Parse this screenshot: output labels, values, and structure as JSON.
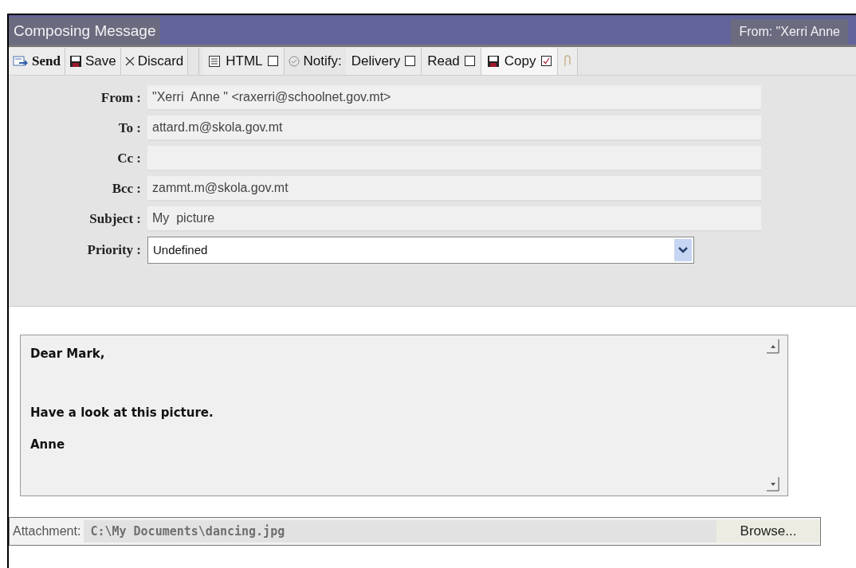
{
  "window": {
    "title": "Composing Message",
    "from_summary": "From: \"Xerri Anne"
  },
  "toolbar": [
    {
      "kind": "button",
      "label": "Send"
    },
    {
      "kind": "button",
      "label": "Save"
    },
    {
      "kind": "button",
      "label": "Discard"
    },
    {
      "kind": "separator"
    },
    {
      "kind": "toggle",
      "label": "HTML",
      "checked": false
    },
    {
      "kind": "label",
      "label": "Notify:"
    },
    {
      "kind": "toggle",
      "label": "Delivery",
      "checked": false
    },
    {
      "kind": "toggle",
      "label": "Read",
      "checked": false
    },
    {
      "kind": "toggle",
      "label": "Copy",
      "checked": true
    },
    {
      "kind": "button"
    }
  ],
  "fields": [
    {
      "label": "From :",
      "value": "\"Xerri  Anne \" <raxerri@schoolnet.gov.mt>"
    },
    {
      "label": "To :",
      "value": "attard.m@skola.gov.mt"
    },
    {
      "label": "Cc :"
    },
    {
      "label": "Bcc :",
      "value": "zammt.m@skola.gov.mt"
    },
    {
      "label": "Subject :",
      "value": "My  picture"
    }
  ],
  "priority": {
    "label": "Priority :",
    "value": "Undefined"
  },
  "body": [
    "Dear Mark,",
    "Have a look at this picture.",
    "Anne"
  ],
  "attachment": {
    "label": "Attachment:",
    "value": "C:\\My Documents\\dancing.jpg",
    "button": "Browse..."
  }
}
